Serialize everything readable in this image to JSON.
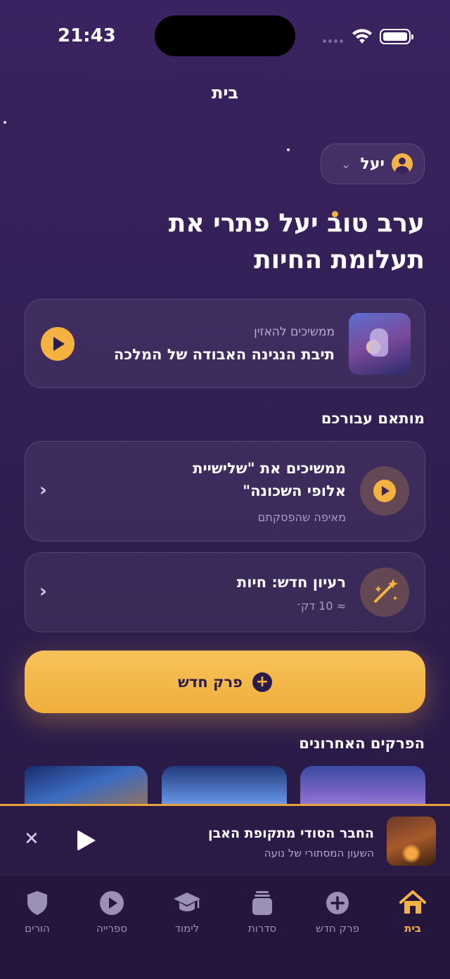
{
  "status": {
    "time": "21:43"
  },
  "nav": {
    "title": "בית"
  },
  "user": {
    "name": "יעל"
  },
  "greeting": {
    "line1": "ערב טוב יעל פתרי את",
    "line2": "תעלומת החיות"
  },
  "continue_listening": {
    "kicker": "ממשיכים להאזין",
    "title": "תיבת הנגינה האבודה של המלכה"
  },
  "recommended": {
    "title": "מותאם עבורכם",
    "items": [
      {
        "title_line1": "ממשיכים את \"שלישיית",
        "title_line2": "אלופי השכונה\"",
        "subtitle": "מאיפה שהפסקתם",
        "icon": "play-icon"
      },
      {
        "title_line1": "רעיון חדש: חיות",
        "subtitle": "≈ 10 דק׳",
        "icon": "magic-wand-icon"
      }
    ]
  },
  "new_chapter_button": {
    "label": "פרק חדש"
  },
  "recent": {
    "title": "הפרקים האחרונים"
  },
  "mini_player": {
    "title": "החבר הסודי מתקופת האבן",
    "subtitle": "השעון המסתורי של נועה"
  },
  "tabbar": {
    "active_color": "#f4b340",
    "items": [
      {
        "label": "בית",
        "icon": "home-icon"
      },
      {
        "label": "פרק חדש",
        "icon": "plus-circle-icon"
      },
      {
        "label": "סדרות",
        "icon": "series-icon"
      },
      {
        "label": "לימוד",
        "icon": "graduation-cap-icon"
      },
      {
        "label": "ספרייה",
        "icon": "play-circle-icon"
      },
      {
        "label": "הורים",
        "icon": "shield-icon"
      }
    ]
  }
}
